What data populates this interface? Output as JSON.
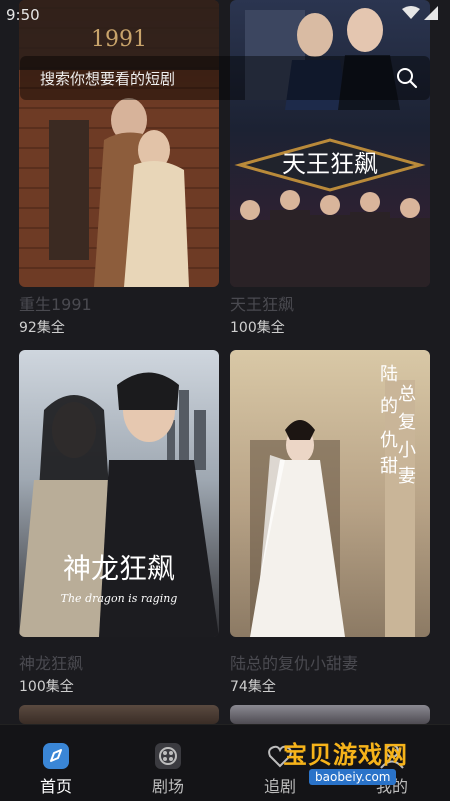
{
  "status_bar": {
    "time": "9:50"
  },
  "search": {
    "placeholder": "搜索你想要看的短剧"
  },
  "dramas": [
    {
      "title": "重生1991",
      "episodes": "92集全",
      "poster_text": "1991"
    },
    {
      "title": "天王狂飙",
      "episodes": "100集全",
      "poster_text": "天王狂飙"
    },
    {
      "title": "神龙狂飙",
      "episodes": "100集全",
      "poster_text": "神龙狂飙",
      "poster_subtext": "The dragon is raging"
    },
    {
      "title": "陆总的复仇小甜妻",
      "episodes": "74集全",
      "poster_text": "陆总的复仇小甜妻"
    }
  ],
  "bottom_nav": [
    {
      "label": "首页",
      "icon": "home-icon",
      "active": true
    },
    {
      "label": "剧场",
      "icon": "film-reel-icon",
      "active": false
    },
    {
      "label": "追剧",
      "icon": "heart-icon",
      "active": false
    },
    {
      "label": "我的",
      "icon": "user-icon",
      "active": false
    }
  ],
  "watermark": {
    "text": "宝贝游戏网",
    "url": "baobeiy.com"
  },
  "colors": {
    "background": "#1b1b1f",
    "accent": "#3a86d6",
    "title_text": "#4a4a50"
  }
}
